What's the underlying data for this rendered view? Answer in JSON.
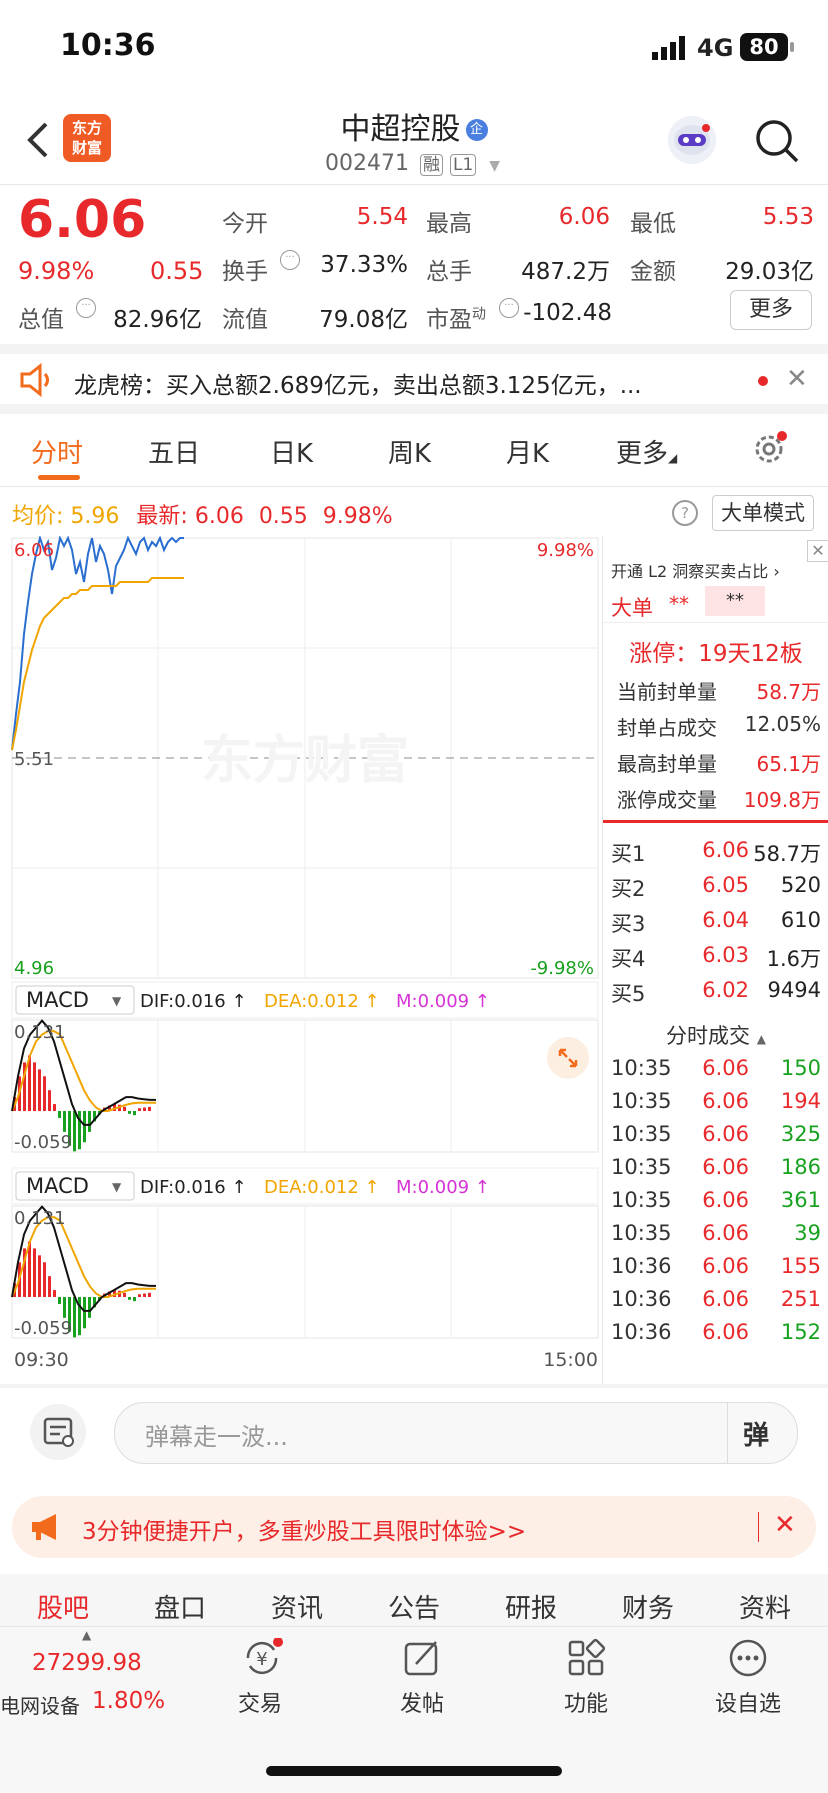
{
  "status": {
    "time": "10:36",
    "network": "4G",
    "battery": "80"
  },
  "header": {
    "title": "中超控股",
    "badge": "企",
    "code": "002471",
    "tags": [
      "融",
      "L1"
    ],
    "logo_text": "东方财富"
  },
  "quote": {
    "price": "6.06",
    "change_pct": "9.98%",
    "change": "0.55",
    "rows": [
      [
        {
          "label": "今开",
          "value": "5.54",
          "color": "red"
        },
        {
          "label": "最高",
          "value": "6.06",
          "color": "red"
        },
        {
          "label": "最低",
          "value": "5.53",
          "color": "red"
        }
      ],
      [
        {
          "label": "换手",
          "value": "37.33%",
          "color": "dark"
        },
        {
          "label": "总手",
          "value": "487.2万",
          "color": "dark"
        },
        {
          "label": "金额",
          "value": "29.03亿",
          "color": "dark"
        }
      ]
    ],
    "mktcap_label": "总值",
    "mktcap": "82.96亿",
    "float_label": "流值",
    "float": "79.08亿",
    "pe_label": "市盈",
    "pe_sup": "动",
    "pe": "-102.48",
    "more_button": "更多"
  },
  "notice": {
    "text": "龙虎榜：买入总额2.689亿元，卖出总额3.125亿元，..."
  },
  "tabs": {
    "items": [
      "分时",
      "五日",
      "日K",
      "周K",
      "月K",
      "更多"
    ],
    "active": 0
  },
  "chart_bar": {
    "avg_label": "均价:",
    "avg": "5.96",
    "latest_label": "最新:",
    "latest": "6.06",
    "chg": "0.55",
    "pct": "9.98%",
    "mode_button": "大单模式"
  },
  "chart_data": {
    "type": "line",
    "ylim": [
      4.96,
      6.06
    ],
    "y_labels_left": [
      "6.06",
      "5.51",
      "4.96"
    ],
    "y_labels_right": [
      "9.98%",
      "-9.98%"
    ],
    "x_labels": [
      "09:30",
      "15:00"
    ],
    "watermark": "东方财富",
    "series": [
      {
        "color": "#2a6fd0",
        "values": [
          5.53,
          5.62,
          5.7,
          5.82,
          5.9,
          5.97,
          6.02,
          6.06,
          6.03,
          6.05,
          5.98,
          6.01,
          6.06,
          6.04,
          6.06,
          6.03,
          5.97,
          6.0,
          5.95,
          6.02,
          6.06,
          6.0,
          6.04,
          6.02,
          5.98,
          5.92,
          5.99,
          6.01,
          6.03,
          6.06,
          6.04,
          6.02,
          6.05,
          6.06,
          6.03,
          6.05,
          6.04,
          6.06,
          6.03,
          6.05,
          6.06,
          6.05,
          6.06,
          6.06
        ]
      },
      {
        "color": "#f0a500",
        "values": [
          5.53,
          5.58,
          5.64,
          5.7,
          5.74,
          5.78,
          5.81,
          5.84,
          5.86,
          5.87,
          5.88,
          5.89,
          5.9,
          5.91,
          5.91,
          5.92,
          5.92,
          5.93,
          5.93,
          5.93,
          5.94,
          5.94,
          5.94,
          5.94,
          5.94,
          5.94,
          5.94,
          5.95,
          5.95,
          5.95,
          5.95,
          5.95,
          5.95,
          5.95,
          5.95,
          5.96,
          5.96,
          5.96,
          5.96,
          5.96,
          5.96,
          5.96,
          5.96,
          5.96
        ]
      }
    ]
  },
  "macd": {
    "label": "MACD",
    "dif": "DIF:0.016 ↑",
    "dea": "DEA:0.012 ↑",
    "m": "M:0.009 ↑",
    "top": "0.131",
    "bottom": "-0.059",
    "dif_values": [
      0.0,
      0.05,
      0.09,
      0.11,
      0.12,
      0.13,
      0.12,
      0.1,
      0.07,
      0.04,
      0.01,
      -0.01,
      -0.02,
      -0.02,
      -0.01,
      0.0,
      0.005,
      0.01,
      0.015,
      0.02,
      0.02,
      0.018,
      0.017,
      0.016,
      0.016
    ],
    "dea_values": [
      0.0,
      0.02,
      0.05,
      0.08,
      0.1,
      0.11,
      0.115,
      0.115,
      0.11,
      0.09,
      0.07,
      0.05,
      0.03,
      0.015,
      0.005,
      0.0,
      0.0,
      0.003,
      0.006,
      0.009,
      0.011,
      0.012,
      0.012,
      0.012,
      0.012
    ],
    "hist": [
      0.02,
      0.05,
      0.07,
      0.08,
      0.07,
      0.06,
      0.05,
      0.03,
      0.01,
      -0.01,
      -0.03,
      -0.05,
      -0.058,
      -0.055,
      -0.045,
      -0.03,
      -0.015,
      -0.005,
      0.005,
      0.008,
      0.01,
      0.009,
      0.006,
      -0.004,
      -0.006,
      0.004,
      0.005,
      0.006
    ]
  },
  "side": {
    "l2_text": "开通 L2 洞察买卖占比",
    "big_label": "大单",
    "big_val": "**",
    "big_val2": "**",
    "limit_title": "涨停：19天12板",
    "stats": [
      {
        "label": "当前封单量",
        "value": "58.7万"
      },
      {
        "label": "封单占成交",
        "value": "12.05%"
      },
      {
        "label": "最高封单量",
        "value": "65.1万"
      },
      {
        "label": "涨停成交量",
        "value": "109.8万"
      }
    ],
    "bids": [
      {
        "label": "买1",
        "price": "6.06",
        "vol": "58.7万"
      },
      {
        "label": "买2",
        "price": "6.05",
        "vol": "520"
      },
      {
        "label": "买3",
        "price": "6.04",
        "vol": "610"
      },
      {
        "label": "买4",
        "price": "6.03",
        "vol": "1.6万"
      },
      {
        "label": "买5",
        "price": "6.02",
        "vol": "9494"
      }
    ],
    "ticks_title": "分时成交",
    "ticks": [
      {
        "time": "10:35",
        "price": "6.06",
        "vol": "150",
        "vc": "green"
      },
      {
        "time": "10:35",
        "price": "6.06",
        "vol": "194",
        "vc": "red"
      },
      {
        "time": "10:35",
        "price": "6.06",
        "vol": "325",
        "vc": "green"
      },
      {
        "time": "10:35",
        "price": "6.06",
        "vol": "186",
        "vc": "green"
      },
      {
        "time": "10:35",
        "price": "6.06",
        "vol": "361",
        "vc": "green"
      },
      {
        "time": "10:35",
        "price": "6.06",
        "vol": "39",
        "vc": "green"
      },
      {
        "time": "10:36",
        "price": "6.06",
        "vol": "155",
        "vc": "red"
      },
      {
        "time": "10:36",
        "price": "6.06",
        "vol": "251",
        "vc": "red"
      },
      {
        "time": "10:36",
        "price": "6.06",
        "vol": "152",
        "vc": "green"
      }
    ]
  },
  "danmu": {
    "placeholder": "弹幕走一波...",
    "send": "弹"
  },
  "promo": {
    "text": "3分钟便捷开户，多重炒股工具限时体验>>"
  },
  "bottom_tabs": [
    "股吧",
    "盘口",
    "资讯",
    "公告",
    "研报",
    "财务",
    "资料"
  ],
  "bottom_nav": {
    "index_value": "27299.98",
    "index_name": "电网设备",
    "index_pct": "1.80%",
    "items": [
      "交易",
      "发帖",
      "功能",
      "设自选"
    ]
  },
  "colors": {
    "up": "#e8292b",
    "down": "#18a11f",
    "avg": "#f0a500",
    "price_line": "#2a6fd0",
    "accent": "#f26a1b"
  }
}
